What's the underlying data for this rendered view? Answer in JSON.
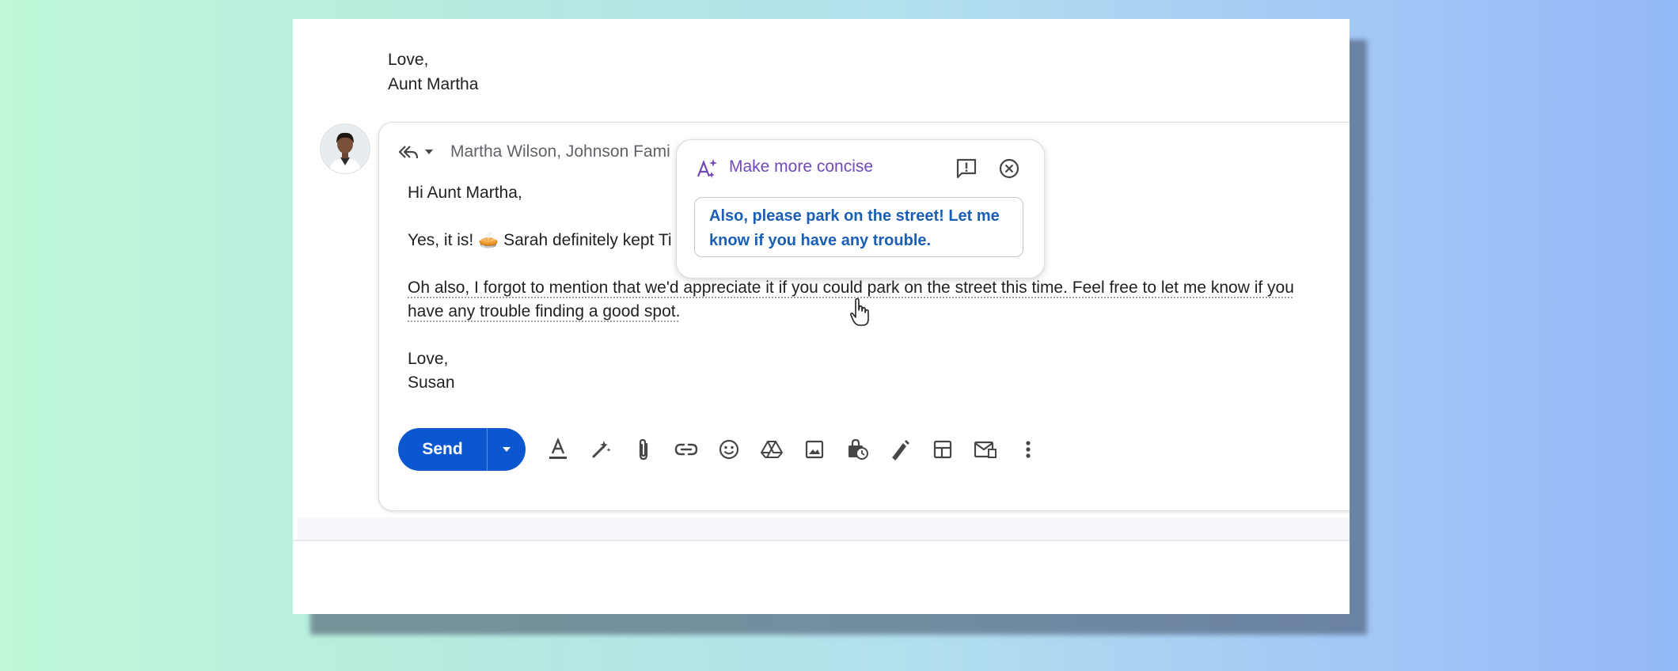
{
  "previous_message": {
    "closing": "Love,",
    "signature": "Aunt Martha"
  },
  "compose": {
    "recipients": "Martha Wilson, Johnson Fami",
    "greeting": "Hi Aunt Martha,",
    "line2_prefix": "Yes, it is!",
    "line2_emoji": "🥧",
    "line2_rest": "Sarah definitely kept Ti",
    "paragraph_line1": "Oh also, I forgot to mention that we'd appreciate it if you could park on the street this time. Feel free to let me know if you",
    "paragraph_line2": "have any trouble finding a good spot.",
    "closing": "Love,",
    "signature": "Susan",
    "send_label": "Send"
  },
  "ai_popup": {
    "title": "Make more concise",
    "suggestion": "Also, please park on the street! Let me know if you have any trouble."
  },
  "toolbar_icons": [
    "format-text-icon",
    "magic-pen-icon",
    "attachment-icon",
    "link-icon",
    "emoji-icon",
    "drive-icon",
    "image-icon",
    "confidential-mode-icon",
    "signature-icon",
    "layout-icon",
    "template-icon",
    "more-options-icon"
  ],
  "colors": {
    "send_button": "#0b57d0",
    "ai_title": "#7248b9",
    "suggestion_text": "#1a5fb4"
  }
}
